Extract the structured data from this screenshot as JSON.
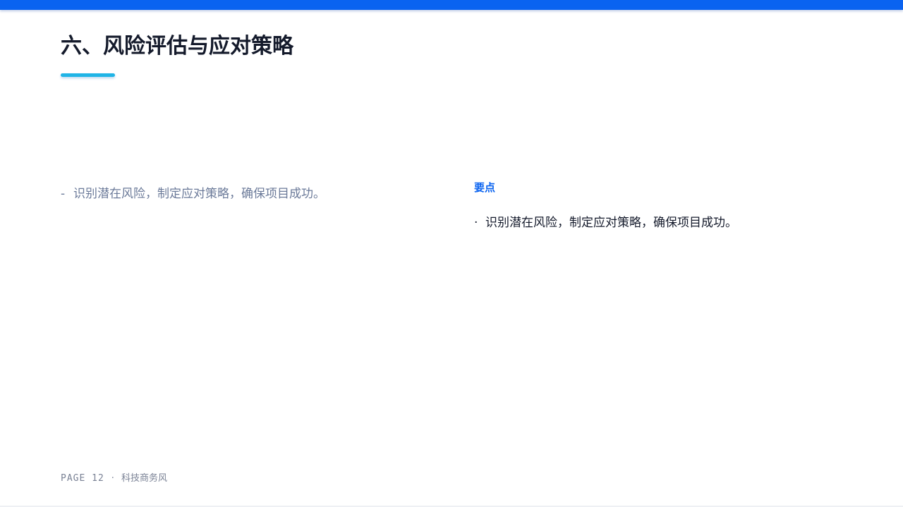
{
  "slide": {
    "title": "六、风险评估与应对策略",
    "left_bullet": {
      "marker": "-",
      "text": "识别潜在风险，制定应对策略，确保项目成功。"
    },
    "key_points": {
      "heading": "要点",
      "items": [
        {
          "marker": "·",
          "text": "识别潜在风险，制定应对策略，确保项目成功。"
        }
      ]
    },
    "footer": {
      "page_label": "PAGE 12",
      "separator": "·",
      "theme": "科技商务风"
    }
  },
  "colors": {
    "accent_bar": "#0a63f0",
    "underline": "#1fb4e6",
    "title_text": "#141a2b",
    "muted_text": "#6b7a99",
    "heading_blue": "#0a63f0"
  }
}
